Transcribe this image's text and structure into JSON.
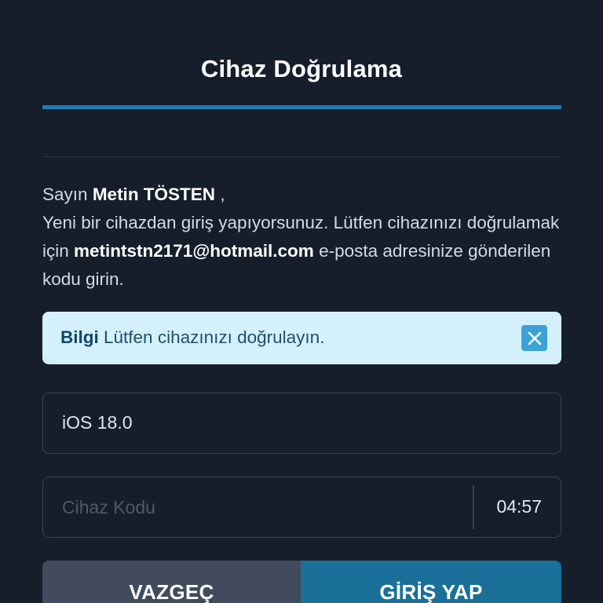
{
  "page": {
    "title": "Cihaz Doğrulama"
  },
  "message": {
    "greeting_prefix": "Sayın",
    "user_name": "Metin TÖSTEN",
    "greeting_suffix": " ,",
    "line2_prefix": "Yeni bir cihazdan giriş yapıyorsunuz. Lütfen cihazınızı doğrulamak için",
    "email": "metintstn2171@hotmail.com",
    "line2_suffix": "e-posta adresinize gönderilen kodu girin."
  },
  "alert": {
    "label": "Bilgi",
    "text": "Lütfen cihazınızı doğrulayın.",
    "close_icon": "close-icon",
    "color": "#d4f1fb"
  },
  "device_field": {
    "value": "iOS 18.0"
  },
  "code_field": {
    "placeholder": "Cihaz Kodu",
    "value": "",
    "timer": "04:57"
  },
  "buttons": {
    "cancel_label": "VAZGEÇ",
    "login_label": "GİRİŞ YAP"
  },
  "colors": {
    "background": "#161e2b",
    "accent": "#1a7fb5",
    "primary_button": "#1a7099",
    "secondary_button": "#424b5d"
  }
}
